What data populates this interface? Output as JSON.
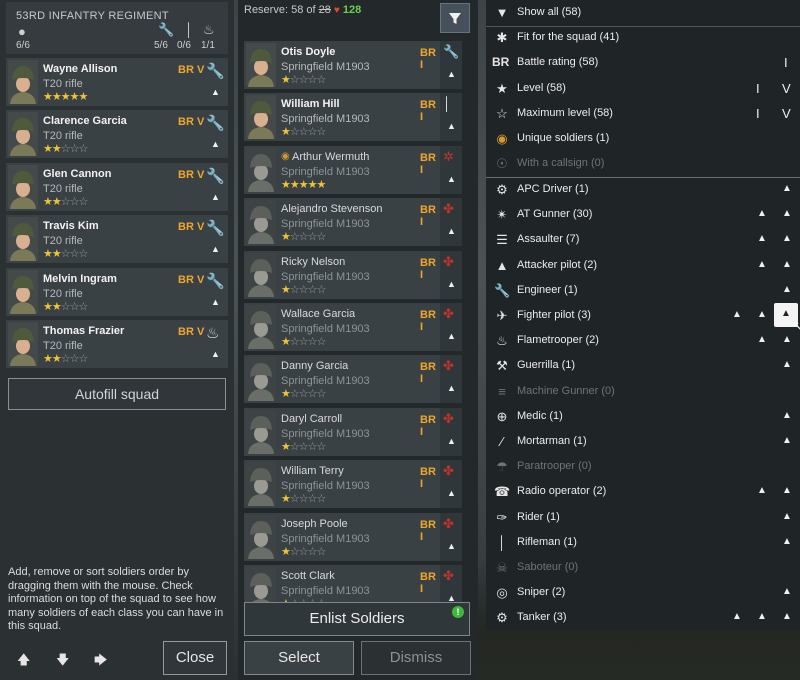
{
  "squad": {
    "title": "53RD INFANTRY REGIMENT",
    "counts": {
      "total": "6/6",
      "engineer": "5/6",
      "rifleman": "0/6",
      "flamer": "1/1"
    },
    "soldiers": [
      {
        "name": "Wayne Allison",
        "weapon": "T20 rifle",
        "br": "BR V",
        "stars": 5,
        "class_icon": "wrench-icon"
      },
      {
        "name": "Clarence Garcia",
        "weapon": "T20 rifle",
        "br": "BR V",
        "stars": 2,
        "class_icon": "wrench-icon"
      },
      {
        "name": "Glen Cannon",
        "weapon": "T20 rifle",
        "br": "BR V",
        "stars": 2,
        "class_icon": "wrench-icon"
      },
      {
        "name": "Travis Kim",
        "weapon": "T20 rifle",
        "br": "BR V",
        "stars": 2,
        "class_icon": "wrench-icon"
      },
      {
        "name": "Melvin Ingram",
        "weapon": "T20 rifle",
        "br": "BR V",
        "stars": 2,
        "class_icon": "wrench-icon"
      },
      {
        "name": "Thomas Frazier",
        "weapon": "T20 rifle",
        "br": "BR V",
        "stars": 2,
        "class_icon": "flame-icon"
      }
    ],
    "autofill_label": "Autofill squad",
    "help_text": "Add, remove or sort soldiers order by dragging them with the mouse. Check information on top of the squad to see how many soldiers of each class you can have in this squad.",
    "close_label": "Close"
  },
  "reserve": {
    "label": "Reserve: 58 of",
    "max": "28",
    "gold": "128",
    "soldiers": [
      {
        "name": "Otis Doyle",
        "weapon": "Springfield M1903",
        "br": "BR I",
        "stars": 1,
        "muted": false,
        "class_icon": "wrench-icon"
      },
      {
        "name": "William Hill",
        "weapon": "Springfield M1903",
        "br": "BR I",
        "stars": 1,
        "muted": false,
        "class_icon": "rifle-icon"
      },
      {
        "name": "Arthur Wermuth",
        "weapon": "Springfield M1903",
        "br": "BR I",
        "stars": 5,
        "muted": true,
        "class_icon": "fighter-icon"
      },
      {
        "name": "Alejandro Stevenson",
        "weapon": "Springfield M1903",
        "br": "BR I",
        "stars": 1,
        "muted": true,
        "class_icon": "tank-icon"
      },
      {
        "name": "Ricky Nelson",
        "weapon": "Springfield M1903",
        "br": "BR I",
        "stars": 1,
        "muted": true,
        "class_icon": "tank-icon"
      },
      {
        "name": "Wallace Garcia",
        "weapon": "Springfield M1903",
        "br": "BR I",
        "stars": 1,
        "muted": true,
        "class_icon": "tank-icon"
      },
      {
        "name": "Danny Garcia",
        "weapon": "Springfield M1903",
        "br": "BR I",
        "stars": 1,
        "muted": true,
        "class_icon": "tank-icon"
      },
      {
        "name": "Daryl Carroll",
        "weapon": "Springfield M1903",
        "br": "BR I",
        "stars": 1,
        "muted": true,
        "class_icon": "tank-icon"
      },
      {
        "name": "William Terry",
        "weapon": "Springfield M1903",
        "br": "BR I",
        "stars": 1,
        "muted": true,
        "class_icon": "tank-icon"
      },
      {
        "name": "Joseph Poole",
        "weapon": "Springfield M1903",
        "br": "BR I",
        "stars": 1,
        "muted": true,
        "class_icon": "tank-icon"
      },
      {
        "name": "Scott Clark",
        "weapon": "Springfield M1903",
        "br": "BR I",
        "stars": 1,
        "muted": true,
        "class_icon": "tank-icon"
      }
    ],
    "enlist_label": "Enlist Soldiers",
    "enlist_badge": "!",
    "select_label": "Select",
    "dismiss_label": "Dismiss"
  },
  "filter": {
    "top_items": [
      {
        "icon": "filter-icon",
        "label": "Show all (58)",
        "right": []
      },
      {
        "icon": "squad-fit-icon",
        "label": "Fit for the squad (41)",
        "right": []
      },
      {
        "icon": "br-icon",
        "label": "Battle rating (58)",
        "right": [
          "I"
        ]
      },
      {
        "icon": "star-filled-icon",
        "label": "Level (58)",
        "right": [
          "I",
          "V"
        ]
      },
      {
        "icon": "star-outline-icon",
        "label": "Maximum level (58)",
        "right": [
          "I",
          "V"
        ]
      },
      {
        "icon": "medal-icon",
        "label": "Unique soldiers (1)",
        "right": []
      },
      {
        "icon": "callsign-icon",
        "label": "With a callsign (0)",
        "right": [],
        "dim": true
      }
    ],
    "class_items": [
      {
        "icon": "apc-driver-icon",
        "label": "APC Driver (1)",
        "ranks": [
          0,
          0,
          1
        ]
      },
      {
        "icon": "at-gunner-icon",
        "label": "AT Gunner (30)",
        "ranks": [
          0,
          1,
          1
        ]
      },
      {
        "icon": "assaulter-icon",
        "label": "Assaulter (7)",
        "ranks": [
          0,
          1,
          1
        ]
      },
      {
        "icon": "attacker-pilot-icon",
        "label": "Attacker pilot (2)",
        "ranks": [
          0,
          1,
          1
        ]
      },
      {
        "icon": "engineer-icon",
        "label": "Engineer (1)",
        "ranks": [
          0,
          0,
          1
        ]
      },
      {
        "icon": "fighter-pilot-icon",
        "label": "Fighter pilot (3)",
        "ranks": [
          1,
          1,
          1
        ]
      },
      {
        "icon": "flametrooper-icon",
        "label": "Flametrooper (2)",
        "ranks": [
          0,
          1,
          1
        ]
      },
      {
        "icon": "guerrilla-icon",
        "label": "Guerrilla (1)",
        "ranks": [
          0,
          0,
          1
        ]
      },
      {
        "icon": "machine-gunner-icon",
        "label": "Machine Gunner (0)",
        "ranks": [
          0,
          0,
          0
        ],
        "dim": true
      },
      {
        "icon": "medic-icon",
        "label": "Medic (1)",
        "ranks": [
          0,
          0,
          1
        ]
      },
      {
        "icon": "mortarman-icon",
        "label": "Mortarman (1)",
        "ranks": [
          0,
          0,
          1
        ]
      },
      {
        "icon": "paratrooper-icon",
        "label": "Paratrooper (0)",
        "ranks": [
          0,
          0,
          0
        ],
        "dim": true
      },
      {
        "icon": "radio-operator-icon",
        "label": "Radio operator (2)",
        "ranks": [
          0,
          1,
          1
        ]
      },
      {
        "icon": "rider-icon",
        "label": "Rider (1)",
        "ranks": [
          0,
          0,
          1
        ]
      },
      {
        "icon": "rifleman-icon",
        "label": "Rifleman (1)",
        "ranks": [
          0,
          0,
          1
        ]
      },
      {
        "icon": "saboteur-icon",
        "label": "Saboteur (0)",
        "ranks": [
          0,
          0,
          0
        ],
        "dim": true
      },
      {
        "icon": "sniper-icon",
        "label": "Sniper (2)",
        "ranks": [
          0,
          0,
          1
        ]
      },
      {
        "icon": "tanker-icon",
        "label": "Tanker (3)",
        "ranks": [
          1,
          1,
          1
        ]
      }
    ]
  },
  "colors": {
    "accent_gold": "#f0a629",
    "star": "#f0c238",
    "gold_currency": "#6ccf4a"
  }
}
